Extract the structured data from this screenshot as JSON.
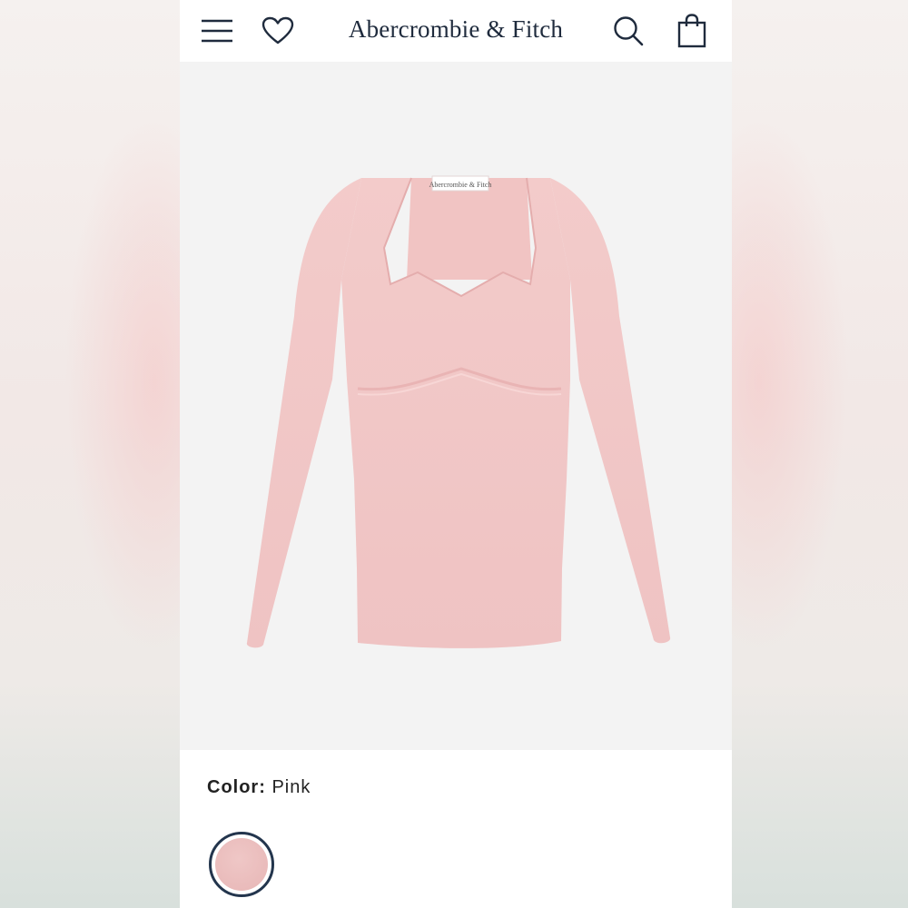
{
  "header": {
    "brand": "Abercrombie & Fitch",
    "menu_icon": "hamburger-menu-icon",
    "wishlist_icon": "heart-icon",
    "search_icon": "search-icon",
    "bag_icon": "shopping-bag-icon"
  },
  "product": {
    "image_tag_text": "Abercrombie & Fitch",
    "garment_color": "#f2c7c6"
  },
  "color_selector": {
    "label": "Color:",
    "value": "Pink",
    "swatch_color": "#e9baba",
    "selected_ring_color": "#23354d"
  }
}
